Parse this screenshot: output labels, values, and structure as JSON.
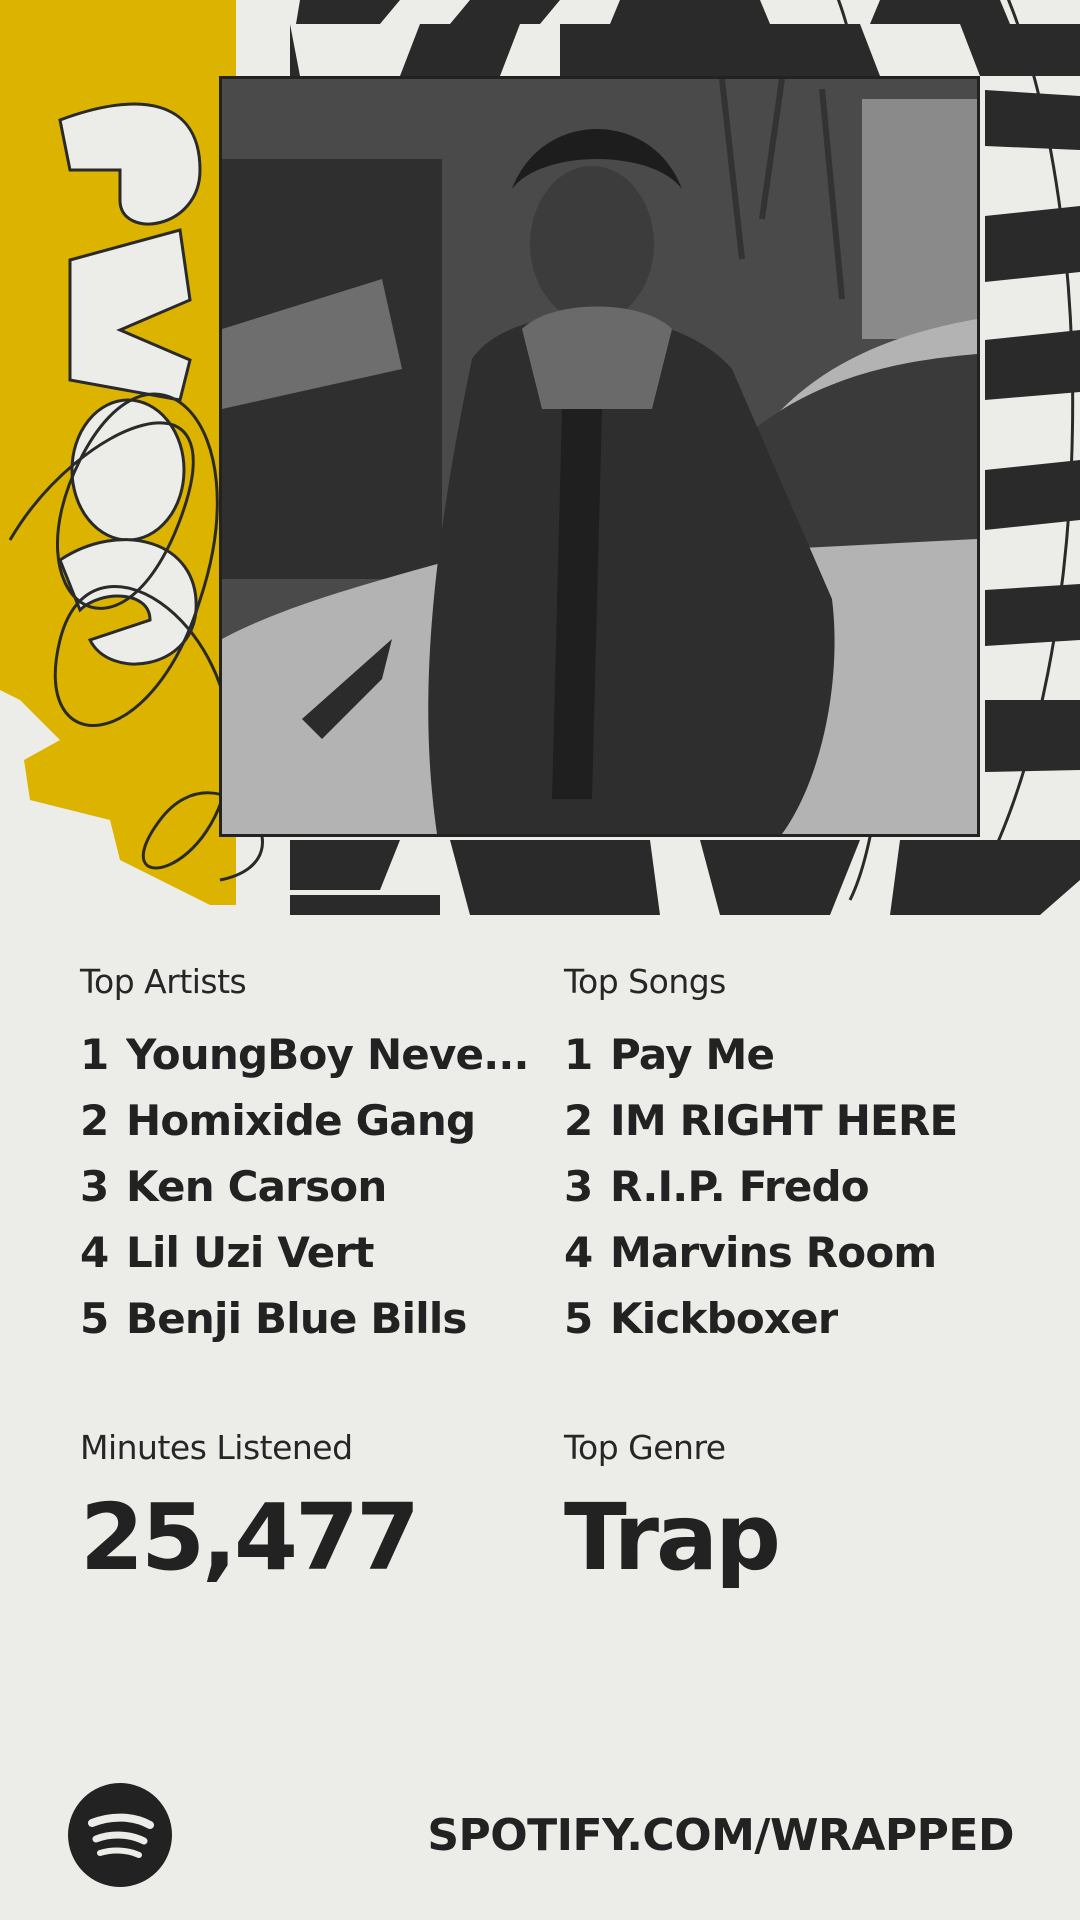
{
  "year_graphic": "2025",
  "photo": {
    "subject": "artist-portrait"
  },
  "top_artists": {
    "label": "Top Artists",
    "items": [
      {
        "rank": "1",
        "name": "YoungBoy Neve..."
      },
      {
        "rank": "2",
        "name": "Homixide Gang"
      },
      {
        "rank": "3",
        "name": "Ken Carson"
      },
      {
        "rank": "4",
        "name": "Lil Uzi Vert"
      },
      {
        "rank": "5",
        "name": "Benji Blue Bills"
      }
    ]
  },
  "top_songs": {
    "label": "Top Songs",
    "items": [
      {
        "rank": "1",
        "name": "Pay Me"
      },
      {
        "rank": "2",
        "name": "IM RIGHT HERE"
      },
      {
        "rank": "3",
        "name": "R.I.P. Fredo"
      },
      {
        "rank": "4",
        "name": "Marvins Room"
      },
      {
        "rank": "5",
        "name": "Kickboxer"
      }
    ]
  },
  "minutes": {
    "label": "Minutes Listened",
    "value": "25,477"
  },
  "genre": {
    "label": "Top Genre",
    "value": "Trap"
  },
  "footer": {
    "url": "SPOTIFY.COM/WRAPPED",
    "logo_icon": "spotify-logo-icon"
  },
  "colors": {
    "background": "#ecece9",
    "ink": "#222222",
    "accent_yellow": "#dcb400"
  }
}
